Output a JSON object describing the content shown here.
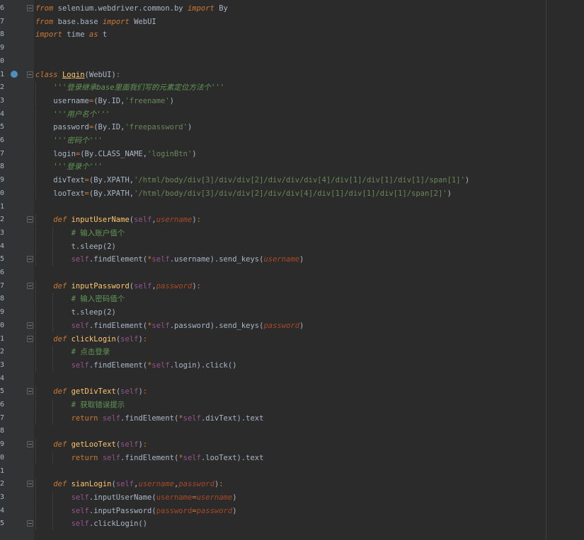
{
  "editor": {
    "lines": [
      {
        "num": "6",
        "text": "from selenium.webdriver.common.by import By"
      },
      {
        "num": "7",
        "text": "from base.base import WebUI"
      },
      {
        "num": "8",
        "text": "import time as t"
      },
      {
        "num": "9",
        "text": ""
      },
      {
        "num": "0",
        "text": ""
      },
      {
        "num": "1",
        "text": "class Login(WebUI):"
      },
      {
        "num": "2",
        "text": "    '''登录继承base里面我们写的元素定位方法个'''"
      },
      {
        "num": "3",
        "text": "    username=(By.ID,'freename')"
      },
      {
        "num": "4",
        "text": "    '''用户名个'''"
      },
      {
        "num": "5",
        "text": "    password=(By.ID,'freepassword')"
      },
      {
        "num": "6",
        "text": "    '''密码个'''"
      },
      {
        "num": "7",
        "text": "    login=(By.CLASS_NAME,'loginBtn')"
      },
      {
        "num": "8",
        "text": "    '''登录个'''"
      },
      {
        "num": "9",
        "text": "    divText=(By.XPATH,'/html/body/div[3]/div/div[2]/div/div/div[4]/div[1]/div[1]/div[1]/span[1]')"
      },
      {
        "num": "0",
        "text": "    looText=(By.XPATH,'/html/body/div[3]/div/div[2]/div/div[4]/div[1]/div[1]/div[1]/span[2]')"
      },
      {
        "num": "1",
        "text": ""
      },
      {
        "num": "2",
        "text": "    def inputUserName(self,username):"
      },
      {
        "num": "3",
        "text": "        # 输入账户值个"
      },
      {
        "num": "4",
        "text": "        t.sleep(2)"
      },
      {
        "num": "5",
        "text": "        self.findElement(*self.username).send_keys(username)"
      },
      {
        "num": "6",
        "text": ""
      },
      {
        "num": "7",
        "text": "    def inputPassword(self,password):"
      },
      {
        "num": "8",
        "text": "        # 输入密码值个"
      },
      {
        "num": "9",
        "text": "        t.sleep(2)"
      },
      {
        "num": "0",
        "text": "        self.findElement(*self.password).send_keys(password)"
      },
      {
        "num": "1",
        "text": "    def clickLogin(self):"
      },
      {
        "num": "2",
        "text": "        # 点击登录"
      },
      {
        "num": "3",
        "text": "        self.findElement(*self.login).click()"
      },
      {
        "num": "4",
        "text": ""
      },
      {
        "num": "5",
        "text": "    def getDivText(self):"
      },
      {
        "num": "6",
        "text": "        # 获取错误提示"
      },
      {
        "num": "7",
        "text": "        return self.findElement(*self.divText).text"
      },
      {
        "num": "8",
        "text": ""
      },
      {
        "num": "9",
        "text": "    def getLooText(self):"
      },
      {
        "num": "0",
        "text": "        return self.findElement(*self.looText).text"
      },
      {
        "num": "1",
        "text": ""
      },
      {
        "num": "2",
        "text": "    def sianLogin(self,username,password):"
      },
      {
        "num": "3",
        "text": "        self.inputUserName(username=username)"
      },
      {
        "num": "4",
        "text": "        self.inputPassword(password=password)"
      },
      {
        "num": "5",
        "text": "        self.clickLogin()"
      }
    ]
  },
  "colors": {
    "background": "#2b2b2b",
    "keyword": "#cc7832",
    "string": "#6a8759",
    "comment": "#629755",
    "self": "#94558d",
    "parameter": "#aa4926",
    "text": "#a9b7c6"
  },
  "icons": {
    "class_marker": "override-marker-icon",
    "fold": "fold-marker-icon"
  }
}
